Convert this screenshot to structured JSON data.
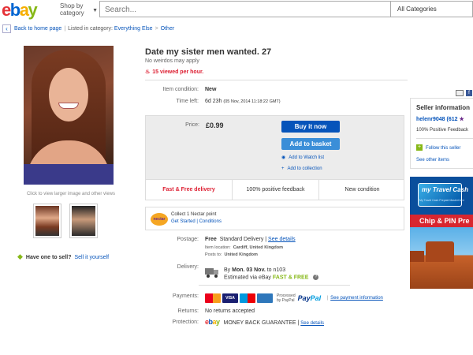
{
  "header": {
    "logo": [
      "e",
      "b",
      "a",
      "y"
    ],
    "shop_by_line1": "Shop by",
    "shop_by_line2": "category",
    "search_placeholder": "Search...",
    "category_select": "All Categories"
  },
  "breadcrumb": {
    "back": "Back to home page",
    "listed_in": "Listed in category:",
    "crumbs": [
      "Everything Else",
      "Other"
    ]
  },
  "gallery": {
    "enlarge_text": "Click to view larger image and other views",
    "thumbnail_count": 2
  },
  "sell": {
    "question": "Have one to sell?",
    "link": "Sell it yourself"
  },
  "item": {
    "title": "Date my sister men wanted. 27",
    "subtitle": "No weirdos may apply",
    "viewed": "15 viewed per hour.",
    "condition_label": "Item condition:",
    "condition_value": "New",
    "time_left_label": "Time left:",
    "time_left_value": "6d 23h",
    "time_left_date": "(05 Nov, 2014  11:18:22 GMT)"
  },
  "price": {
    "label": "Price:",
    "value": "£0.99",
    "buy_now": "Buy it now",
    "add_basket": "Add to basket",
    "watch": "Add to Watch list",
    "collection": "Add to collection"
  },
  "features": [
    "Fast & Free delivery",
    "100% positive feedback",
    "New condition"
  ],
  "nectar": {
    "logo": "nectar",
    "line1": "Collect 1 Nectar point",
    "get_started": "Get Started",
    "conditions": "Conditions"
  },
  "postage": {
    "label": "Postage:",
    "value": "Free",
    "method": "Standard Delivery",
    "see_details": "See details",
    "location_label": "Item location:",
    "location": "Cardiff, United Kingdom",
    "posts_to_label": "Posts to:",
    "posts_to": "United Kingdom"
  },
  "delivery": {
    "label": "Delivery:",
    "by": "By",
    "date": "Mon. 03 Nov.",
    "to": "to n103",
    "estimated": "Estimated via eBay",
    "fast_free": "FAST & FREE",
    "help": "?"
  },
  "payments": {
    "label": "Payments:",
    "visa": "VISA",
    "processed_line1": "Processed",
    "processed_line2": "by PayPal",
    "paypal_a": "Pay",
    "paypal_b": "Pal",
    "see_payment": "See payment information"
  },
  "returns": {
    "label": "Returns:",
    "value": "No returns accepted"
  },
  "protection": {
    "label": "Protection:",
    "value": "MONEY BACK GUARANTEE",
    "see_details": "See details"
  },
  "seller": {
    "title": "Seller information",
    "name": "helenr9048",
    "feedback_score": "(612",
    "positive": "100% Positive Feedback",
    "follow": "Follow this seller",
    "other_items": "See other items"
  },
  "ad": {
    "card_title": "my Travel Cash",
    "card_sub": "My Travel Cash Prepaid MasterCard",
    "chip": "Chip & PIN Pre"
  },
  "colors": {
    "ebay_red": "#e53238",
    "ebay_blue": "#0064d2",
    "ebay_yellow": "#f5af02",
    "ebay_green": "#86b817",
    "link_blue": "#0654ba",
    "alert_red": "#dd1e31"
  }
}
